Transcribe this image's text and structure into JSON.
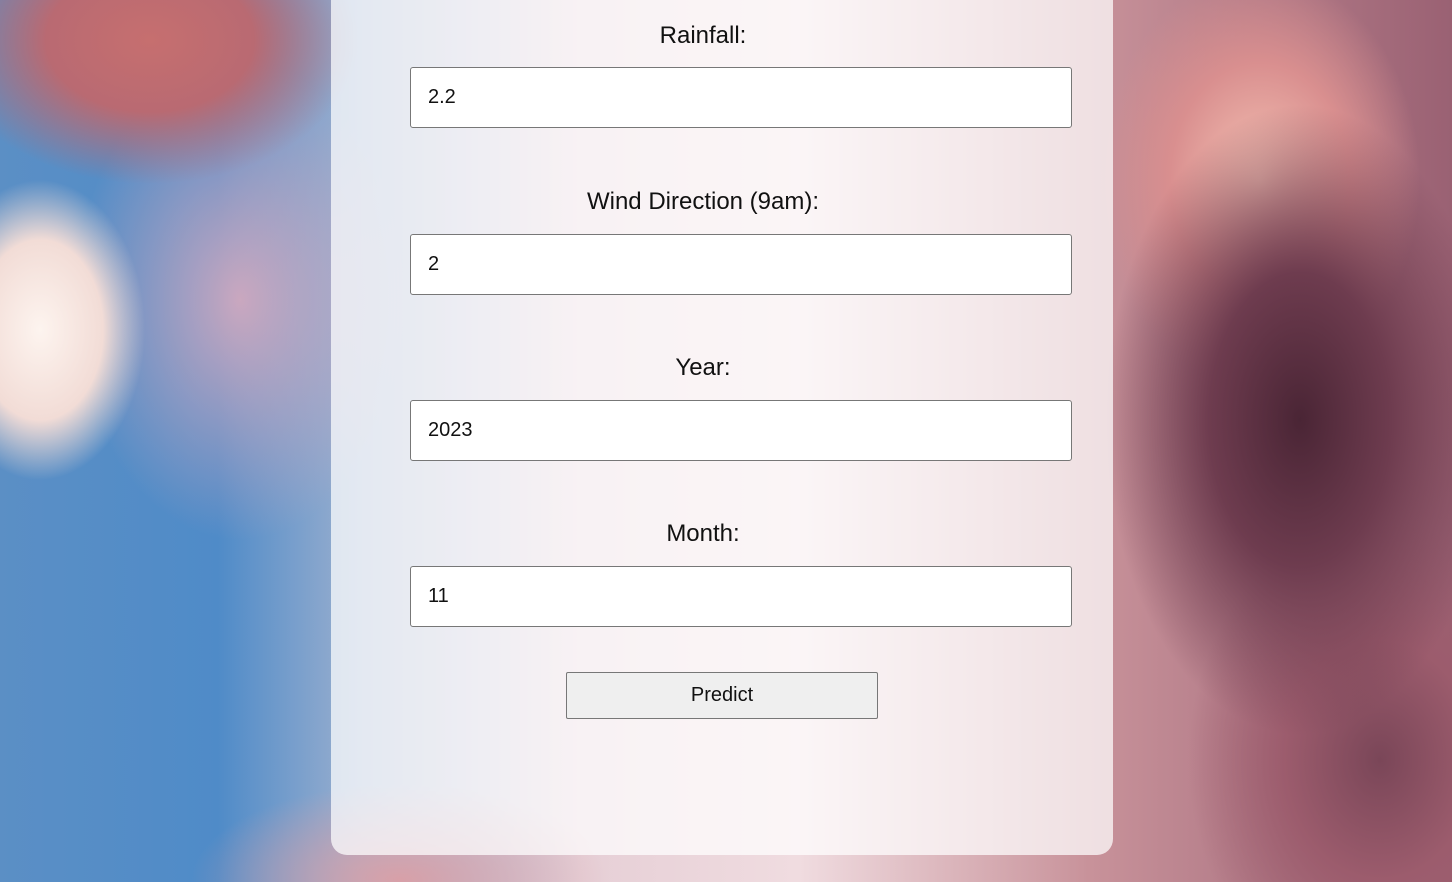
{
  "form": {
    "fields": [
      {
        "label": "Rainfall:",
        "value": "2.2"
      },
      {
        "label": "Wind Direction (9am):",
        "value": "2"
      },
      {
        "label": "Year:",
        "value": "2023"
      },
      {
        "label": "Month:",
        "value": "11"
      }
    ],
    "submit_label": "Predict"
  }
}
